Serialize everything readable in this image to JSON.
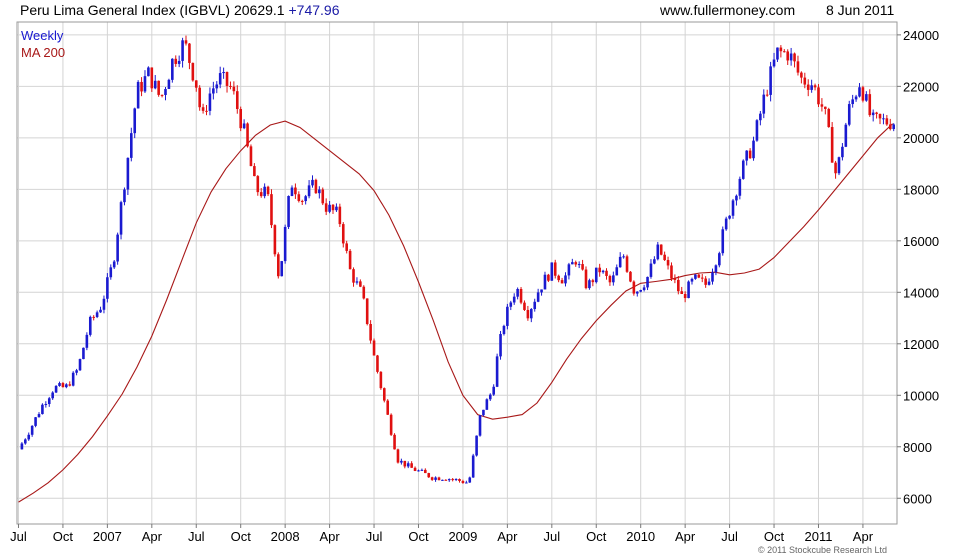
{
  "header": {
    "title": "Peru Lima General Index (IGBVL) 20629.1",
    "change": "+747.96",
    "source": "www.fullermoney.com",
    "date": "8 Jun 2011",
    "copyright": "© 2011 Stockcube Research Ltd"
  },
  "chart_data": {
    "type": "line",
    "title": "Peru Lima General Index (IGBVL) 20629.1",
    "xlabel": "",
    "ylabel": "",
    "ylim": [
      5000,
      24500
    ],
    "yticks": [
      6000,
      8000,
      10000,
      12000,
      14000,
      16000,
      18000,
      20000,
      22000,
      24000
    ],
    "xtick_labels": [
      "Jul",
      "Oct",
      "2007",
      "Apr",
      "Jul",
      "Oct",
      "2008",
      "Apr",
      "Jul",
      "Oct",
      "2009",
      "Apr",
      "Jul",
      "Oct",
      "2010",
      "Apr",
      "Jul",
      "Oct",
      "2011",
      "Apr"
    ],
    "xtick_month_index": [
      0,
      3,
      6,
      9,
      12,
      15,
      18,
      21,
      24,
      27,
      30,
      33,
      36,
      39,
      42,
      45,
      48,
      51,
      54,
      57
    ],
    "x_range_months": [
      -0.1,
      59.3
    ],
    "grid": true,
    "legend_position": "top-left",
    "series": [
      {
        "name": "Weekly",
        "style": "weekly bars, blue up / red down",
        "color_up": "#1a1ad0",
        "color_down": "#e01010",
        "x": [
          0.0,
          0.8,
          1.6,
          2.4,
          3.2,
          4.0,
          4.8,
          5.6,
          6.4,
          7.2,
          8.0,
          8.8,
          9.6,
          10.4,
          11.2,
          12.0,
          12.4,
          12.8,
          13.2,
          13.6,
          14.4,
          15.2,
          16.0,
          16.8,
          17.6,
          18.4,
          19.2,
          20.0,
          20.8,
          21.6,
          22.4,
          23.2,
          24.0,
          24.8,
          25.6,
          26.4,
          27.2,
          28.0,
          28.8,
          29.6,
          30.4,
          31.2,
          32.0,
          32.4,
          32.8,
          33.2,
          33.6,
          34.4,
          35.2,
          36.0,
          36.8,
          37.6,
          38.4,
          39.2,
          40.0,
          40.8,
          41.6,
          42.4,
          43.2,
          44.0,
          44.8,
          45.6,
          46.4,
          47.2,
          48.0,
          48.8,
          49.6,
          50.4,
          51.2,
          52.0,
          52.8,
          53.6,
          54.4,
          55.2,
          56.0,
          56.8,
          57.6,
          58.4,
          59.2
        ],
        "values": [
          7900,
          8700,
          9600,
          10300,
          10300,
          11000,
          12800,
          13500,
          15200,
          18500,
          21800,
          22500,
          21500,
          23000,
          23700,
          22100,
          20600,
          21600,
          22000,
          22300,
          21900,
          20300,
          18000,
          17800,
          14500,
          18300,
          17600,
          18200,
          17300,
          17000,
          14800,
          13900,
          11500,
          9500,
          7500,
          7200,
          7000,
          6800,
          6800,
          6700,
          6600,
          9300,
          10200,
          11800,
          12900,
          13600,
          14200,
          13200,
          14200,
          14900,
          14500,
          15300,
          14200,
          14900,
          14300,
          15500,
          14000,
          14500,
          15700,
          14700,
          13800,
          14500,
          14300,
          15500,
          17200,
          18700,
          19800,
          21700,
          23300,
          23300,
          22300,
          22100,
          21000,
          18500,
          21000,
          22200,
          20629,
          20629,
          20629
        ]
      },
      {
        "name": "MA 200",
        "color": "#a81818",
        "x": [
          0,
          1,
          2,
          3,
          4,
          5,
          6,
          7,
          8,
          9,
          10,
          11,
          12,
          13,
          14,
          15,
          16,
          17,
          18,
          19,
          20,
          21,
          22,
          23,
          24,
          25,
          26,
          27,
          28,
          29,
          30,
          31,
          32,
          33,
          34,
          35,
          36,
          37,
          38,
          39,
          40,
          41,
          42,
          43,
          44,
          45,
          46,
          47,
          48,
          49,
          50,
          51,
          52,
          53,
          54,
          55,
          56,
          57,
          58,
          59
        ],
        "values": [
          5850,
          6200,
          6600,
          7100,
          7700,
          8400,
          9200,
          10050,
          11100,
          12300,
          13700,
          15200,
          16700,
          17900,
          18800,
          19500,
          20100,
          20500,
          20650,
          20400,
          19950,
          19500,
          19050,
          18600,
          17950,
          17000,
          15800,
          14400,
          12900,
          11300,
          10000,
          9250,
          9070,
          9150,
          9250,
          9700,
          10500,
          11400,
          12200,
          12900,
          13500,
          14050,
          14350,
          14420,
          14500,
          14650,
          14750,
          14780,
          14680,
          14750,
          14900,
          15350,
          15950,
          16550,
          17200,
          17900,
          18600,
          19300,
          20000,
          20550
        ]
      }
    ]
  }
}
